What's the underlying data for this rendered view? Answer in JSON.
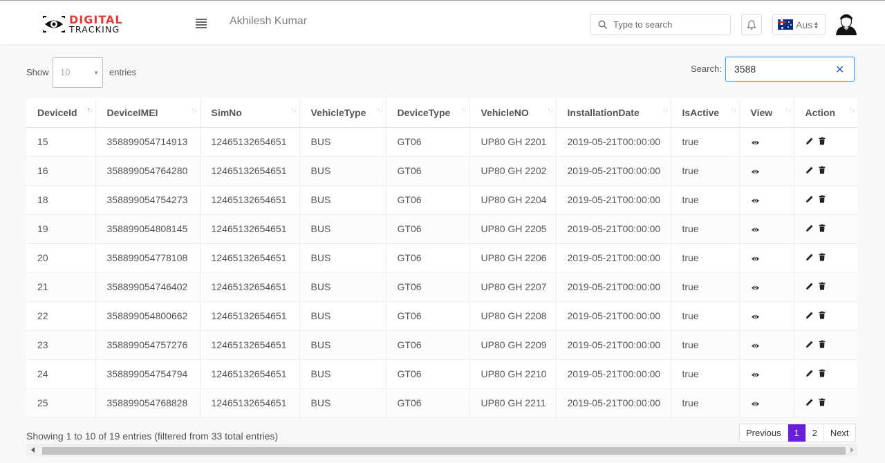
{
  "header": {
    "brand_line1": "DIGITAL",
    "brand_line2": "TRACKING",
    "user_name": "Akhilesh Kumar",
    "search_placeholder": "Type to search",
    "language": "Aus"
  },
  "table_controls": {
    "show_label": "Show",
    "page_length": "10",
    "entries_label": "entries",
    "search_label": "Search:",
    "search_value": "3588"
  },
  "columns": [
    "DeviceId",
    "DeviceIMEI",
    "SimNo",
    "VehicleType",
    "DeviceType",
    "VehicleNO",
    "InstallationDate",
    "IsActive",
    "View",
    "Action"
  ],
  "rows": [
    {
      "DeviceId": "15",
      "DeviceIMEI": "358899054714913",
      "SimNo": "12465132654651",
      "VehicleType": "BUS",
      "DeviceType": "GT06",
      "VehicleNO": "UP80 GH 2201",
      "InstallationDate": "2019-05-21T00:00:00",
      "IsActive": "true"
    },
    {
      "DeviceId": "16",
      "DeviceIMEI": "358899054764280",
      "SimNo": "12465132654651",
      "VehicleType": "BUS",
      "DeviceType": "GT06",
      "VehicleNO": "UP80 GH 2202",
      "InstallationDate": "2019-05-21T00:00:00",
      "IsActive": "true"
    },
    {
      "DeviceId": "18",
      "DeviceIMEI": "358899054754273",
      "SimNo": "12465132654651",
      "VehicleType": "BUS",
      "DeviceType": "GT06",
      "VehicleNO": "UP80 GH 2204",
      "InstallationDate": "2019-05-21T00:00:00",
      "IsActive": "true"
    },
    {
      "DeviceId": "19",
      "DeviceIMEI": "358899054808145",
      "SimNo": "12465132654651",
      "VehicleType": "BUS",
      "DeviceType": "GT06",
      "VehicleNO": "UP80 GH 2205",
      "InstallationDate": "2019-05-21T00:00:00",
      "IsActive": "true"
    },
    {
      "DeviceId": "20",
      "DeviceIMEI": "358899054778108",
      "SimNo": "12465132654651",
      "VehicleType": "BUS",
      "DeviceType": "GT06",
      "VehicleNO": "UP80 GH 2206",
      "InstallationDate": "2019-05-21T00:00:00",
      "IsActive": "true"
    },
    {
      "DeviceId": "21",
      "DeviceIMEI": "358899054746402",
      "SimNo": "12465132654651",
      "VehicleType": "BUS",
      "DeviceType": "GT06",
      "VehicleNO": "UP80 GH 2207",
      "InstallationDate": "2019-05-21T00:00:00",
      "IsActive": "true"
    },
    {
      "DeviceId": "22",
      "DeviceIMEI": "358899054800662",
      "SimNo": "12465132654651",
      "VehicleType": "BUS",
      "DeviceType": "GT06",
      "VehicleNO": "UP80 GH 2208",
      "InstallationDate": "2019-05-21T00:00:00",
      "IsActive": "true"
    },
    {
      "DeviceId": "23",
      "DeviceIMEI": "358899054757276",
      "SimNo": "12465132654651",
      "VehicleType": "BUS",
      "DeviceType": "GT06",
      "VehicleNO": "UP80 GH 2209",
      "InstallationDate": "2019-05-21T00:00:00",
      "IsActive": "true"
    },
    {
      "DeviceId": "24",
      "DeviceIMEI": "358899054754794",
      "SimNo": "12465132654651",
      "VehicleType": "BUS",
      "DeviceType": "GT06",
      "VehicleNO": "UP80 GH 2210",
      "InstallationDate": "2019-05-21T00:00:00",
      "IsActive": "true"
    },
    {
      "DeviceId": "25",
      "DeviceIMEI": "358899054768828",
      "SimNo": "12465132654651",
      "VehicleType": "BUS",
      "DeviceType": "GT06",
      "VehicleNO": "UP80 GH 2211",
      "InstallationDate": "2019-05-21T00:00:00",
      "IsActive": "true"
    }
  ],
  "footer": {
    "info": "Showing 1 to 10 of 19 entries (filtered from 33 total entries)",
    "pagination": {
      "previous": "Previous",
      "pages": [
        "1",
        "2"
      ],
      "current": "1",
      "next": "Next"
    }
  },
  "icons": {
    "menu": "hamburger-menu-icon",
    "search": "magnifier-icon",
    "notifications": "bell-icon",
    "flag": "australia-flag-icon",
    "avatar": "user-avatar-icon",
    "view": "eye-icon",
    "edit": "pencil-icon",
    "delete": "trash-icon",
    "clear": "close-x-icon"
  },
  "colors": {
    "brand_red": "#e53935",
    "pagination_active": "#6a1fd6",
    "search_focus_border": "#4fa0e0"
  }
}
